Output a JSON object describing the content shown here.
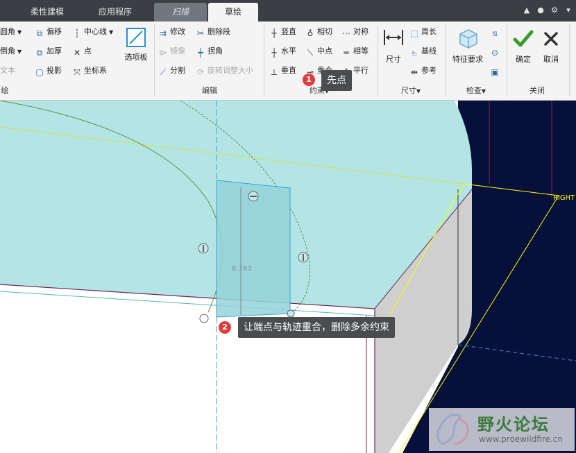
{
  "tabs": [
    {
      "label": "柔性建模"
    },
    {
      "label": "应用程序"
    },
    {
      "label": "扫描"
    },
    {
      "label": "草绘"
    }
  ],
  "ribbon": {
    "left_partial": {
      "fillet": "圆角",
      "chamfer": "倒角",
      "text": "文本",
      "offset": "偏移",
      "thicken": "加厚",
      "project": "投影",
      "centerline": "中心线",
      "point": "点",
      "coord_sys": "坐标系",
      "palette": "选项板",
      "group_label": "绘"
    },
    "edit": {
      "modify": "修改",
      "delete_segment": "删除段",
      "mirror": "镜像",
      "corner": "拐角",
      "divide": "分割",
      "rotate_resize": "旋转调整大小",
      "group_label": "编辑"
    },
    "constrain": {
      "vertical": "竖直",
      "tangent": "相切",
      "symmetric": "对称",
      "horizontal": "水平",
      "midpoint": "中点",
      "equal": "相等",
      "perpendicular": "垂直",
      "coincident": "重合",
      "parallel": "平行",
      "group_label": "约束"
    },
    "dimension": {
      "dimension": "尺寸",
      "perimeter": "周长",
      "baseline": "基线",
      "reference": "参考",
      "group_label": "尺寸"
    },
    "inspect": {
      "feature_req": "特征要求",
      "group_label": "检查"
    },
    "close": {
      "ok": "确定",
      "cancel": "取消",
      "group_label": "关闭"
    }
  },
  "canvas": {
    "dimension_value": "8.783",
    "datum_label": "RIGHT",
    "colors": {
      "part_face": "#b3e5e5",
      "dark_background": "#07103a",
      "side_face": "#cfcfcf",
      "datum_yellow": "#ffff00",
      "selection": "#94d3d9"
    }
  },
  "callouts": [
    {
      "number": "1",
      "text": "先点"
    },
    {
      "number": "2",
      "text": "让端点与轨迹重合，删除多余约束"
    }
  ],
  "watermark": {
    "title": "野火论坛",
    "url": "www.proewildfire.cn"
  }
}
